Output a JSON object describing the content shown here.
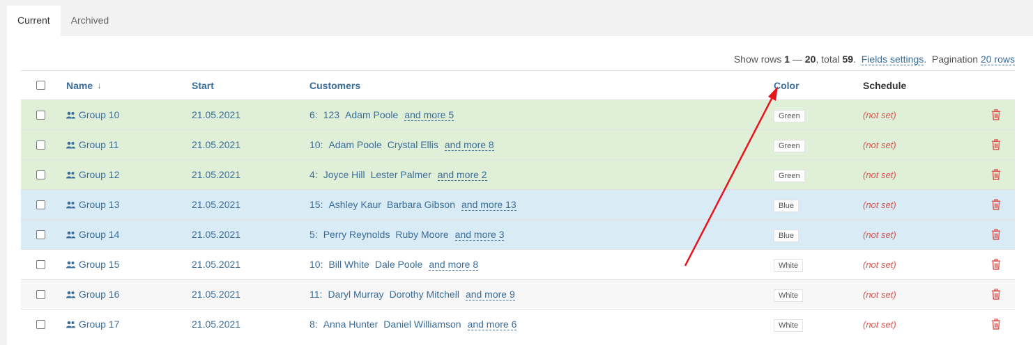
{
  "tabs": [
    {
      "label": "Current",
      "active": true
    },
    {
      "label": "Archived",
      "active": false
    }
  ],
  "summary": {
    "prefix": "Show rows",
    "range_start": "1",
    "dash": "—",
    "range_end": "20",
    "total_label": ", total",
    "total": "59",
    "period": ".",
    "fields_settings": "Fields settings",
    "period2": ".",
    "pagination_label": "Pagination",
    "pagination_value": "20 rows"
  },
  "columns": {
    "name": "Name",
    "sort_indicator": "↓",
    "start": "Start",
    "customers": "Customers",
    "color": "Color",
    "schedule": "Schedule"
  },
  "rows": [
    {
      "name": "Group 10",
      "start": "21.05.2021",
      "count": "6:",
      "customers": [
        "123",
        "Adam Poole"
      ],
      "more": "and more 5",
      "color": "Green",
      "schedule": "(not set)"
    },
    {
      "name": "Group 11",
      "start": "21.05.2021",
      "count": "10:",
      "customers": [
        "Adam Poole",
        "Crystal Ellis"
      ],
      "more": "and more 8",
      "color": "Green",
      "schedule": "(not set)"
    },
    {
      "name": "Group 12",
      "start": "21.05.2021",
      "count": "4:",
      "customers": [
        "Joyce Hill",
        "Lester Palmer"
      ],
      "more": "and more 2",
      "color": "Green",
      "schedule": "(not set)"
    },
    {
      "name": "Group 13",
      "start": "21.05.2021",
      "count": "15:",
      "customers": [
        "Ashley Kaur",
        "Barbara Gibson"
      ],
      "more": "and more 13",
      "color": "Blue",
      "schedule": "(not set)"
    },
    {
      "name": "Group 14",
      "start": "21.05.2021",
      "count": "5:",
      "customers": [
        "Perry Reynolds",
        "Ruby Moore"
      ],
      "more": "and more 3",
      "color": "Blue",
      "schedule": "(not set)"
    },
    {
      "name": "Group 15",
      "start": "21.05.2021",
      "count": "10:",
      "customers": [
        "Bill White",
        "Dale Poole"
      ],
      "more": "and more 8",
      "color": "White",
      "schedule": "(not set)"
    },
    {
      "name": "Group 16",
      "start": "21.05.2021",
      "count": "11:",
      "customers": [
        "Daryl Murray",
        "Dorothy Mitchell"
      ],
      "more": "and more 9",
      "color": "White",
      "schedule": "(not set)"
    },
    {
      "name": "Group 17",
      "start": "21.05.2021",
      "count": "8:",
      "customers": [
        "Anna Hunter",
        "Daniel Williamson"
      ],
      "more": "and more 6",
      "color": "White",
      "schedule": "(not set)"
    }
  ],
  "colors": {
    "accent": "#3a6d9a",
    "row_green": "#e0efd8",
    "row_blue": "#d9ebf5",
    "danger": "#d9534f",
    "annotation_arrow": "#e8141c"
  },
  "icons": {
    "group": "group-icon",
    "delete": "trash-icon",
    "annotation": "red-arrow-annotation"
  }
}
